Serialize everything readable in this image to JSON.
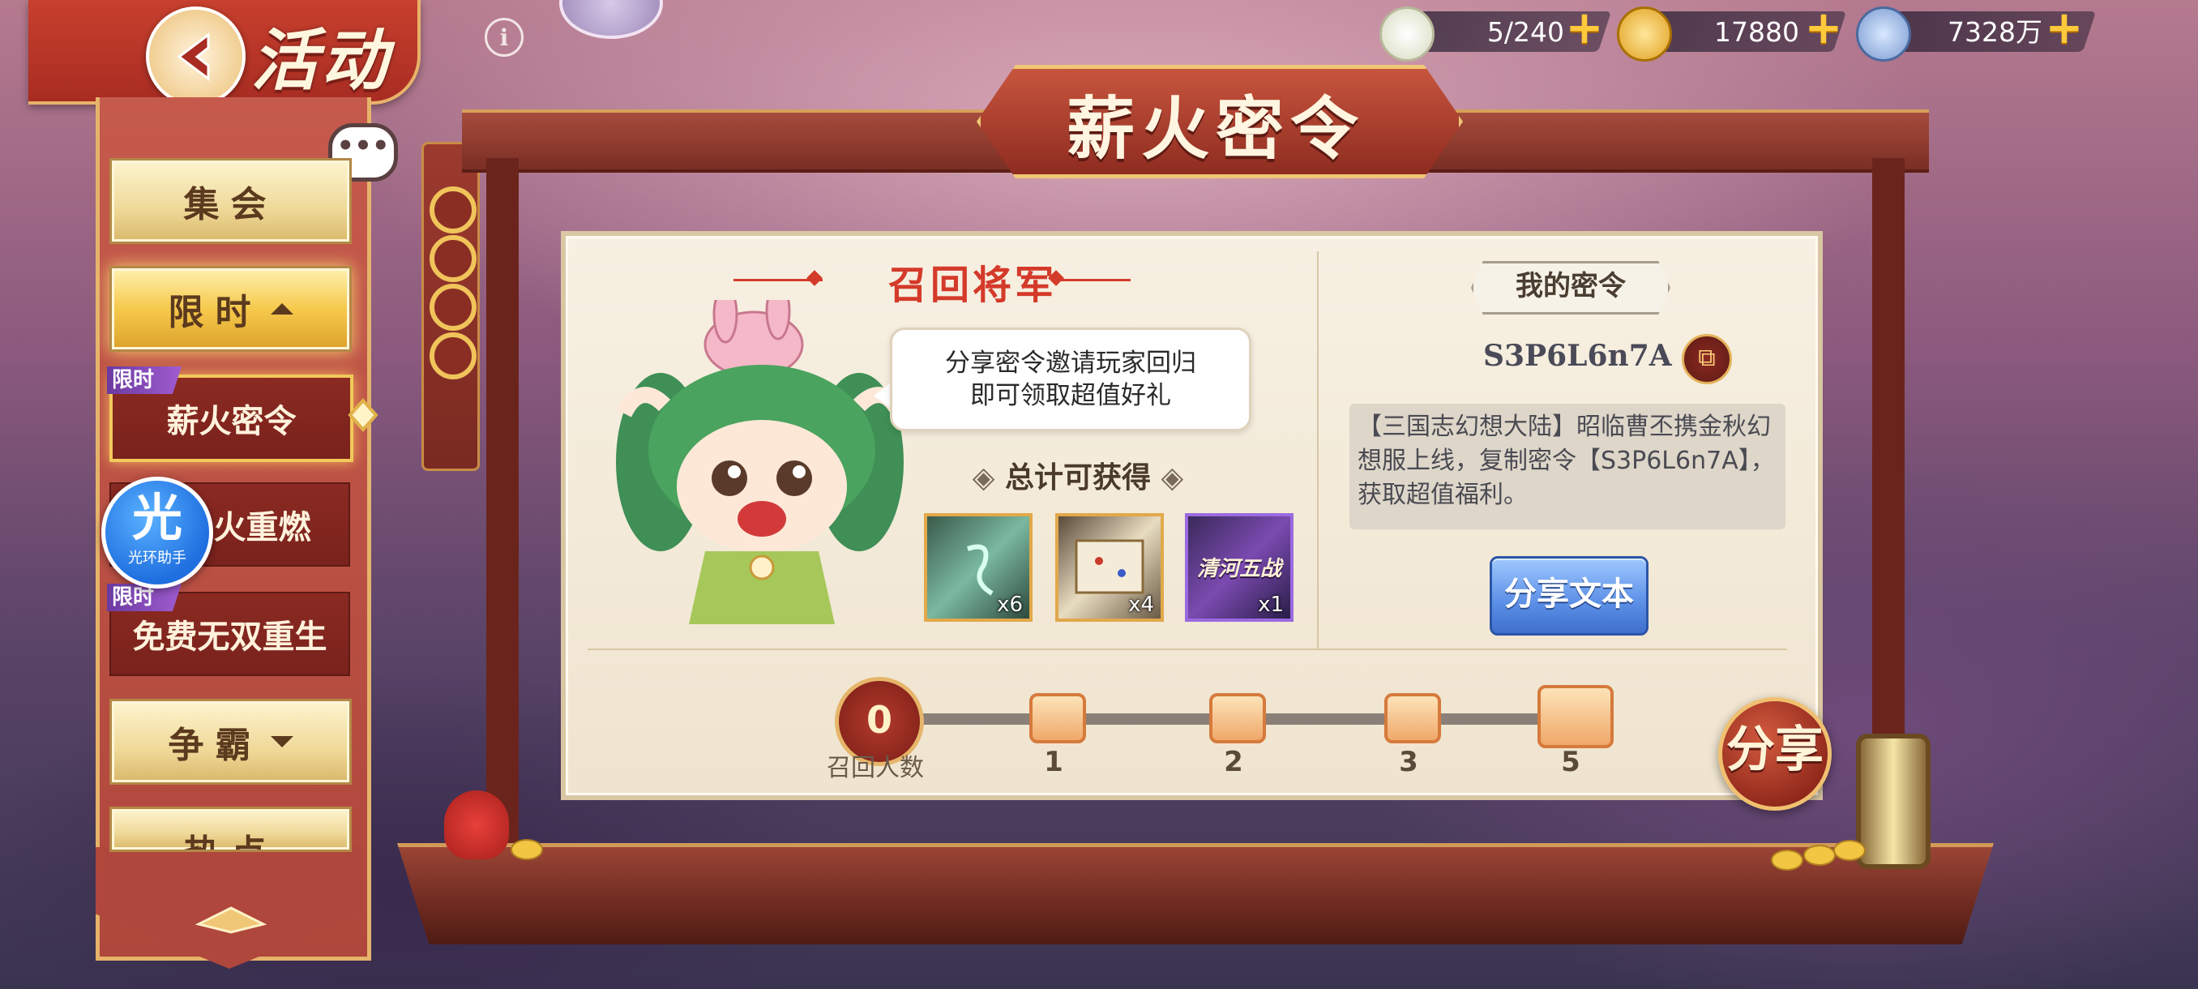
{
  "header": {
    "title": "活动",
    "info_symbol": "i"
  },
  "currencies": [
    {
      "name": "steamed-bun",
      "value": "5/240",
      "icon": "bun-icon"
    },
    {
      "name": "gold-ingot",
      "value": "17880",
      "icon": "gold-ingot-icon"
    },
    {
      "name": "copper-coin",
      "value": "7328万",
      "icon": "copper-coin-icon"
    }
  ],
  "sidebar": {
    "items": [
      {
        "label": "集会",
        "type": "category"
      },
      {
        "label": "限时",
        "type": "category",
        "expanded": true
      },
      {
        "label": "薪火密令",
        "tag": "限时",
        "active": true
      },
      {
        "label": "火重燃",
        "tag": ""
      },
      {
        "label": "免费无双重生",
        "tag": "限时"
      },
      {
        "label": "争霸",
        "type": "category"
      },
      {
        "label": "热点",
        "type": "category"
      }
    ],
    "assistant": {
      "glyph": "光",
      "label": "光环助手"
    }
  },
  "main": {
    "title": "薪火密令",
    "recall": {
      "title": "召回将军",
      "bubble_line1": "分享密令邀请玩家回归",
      "bubble_line2": "即可领取超值好礼",
      "total_label": "总计可获得"
    },
    "rewards": [
      {
        "name": "jade-card",
        "qty": "x6"
      },
      {
        "name": "map-scroll",
        "qty": "x4"
      },
      {
        "name": "qinghe-wuzhan",
        "qty": "x1",
        "art_text": "清河五战"
      }
    ],
    "my_code": {
      "title": "我的密令",
      "code": "S3P6L6n7A",
      "share_text": "【三国志幻想大陆】昭临曹丕携金秋幻想服上线，复制密令【S3P6L6n7A】，获取超值福利。",
      "share_button": "分享文本"
    },
    "progress": {
      "current": "0",
      "label": "召回人数",
      "milestones": [
        "1",
        "2",
        "3",
        "5"
      ]
    },
    "share_button": "分享"
  },
  "colors": {
    "accent_red": "#d43a2a",
    "gold": "#f0c776",
    "panel": "#f7f0e2",
    "blue_button": "#5b8fe6"
  }
}
